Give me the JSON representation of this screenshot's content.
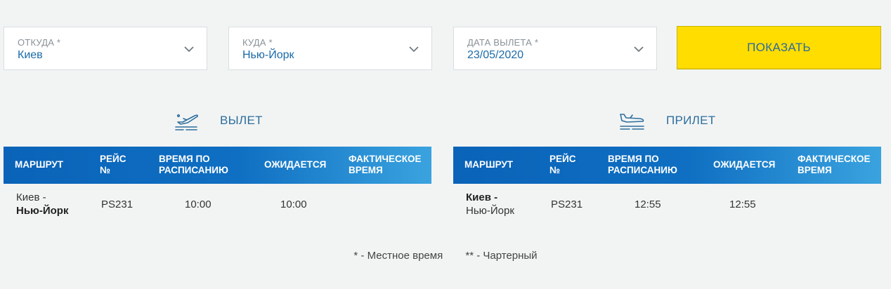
{
  "search": {
    "from": {
      "label": "ОТКУДА *",
      "value": "Киев"
    },
    "to": {
      "label": "КУДА *",
      "value": "Нью-Йорк"
    },
    "date": {
      "label": "ДАТА ВЫЛЕТА *",
      "value": "23/05/2020"
    },
    "show_button": "ПОКАЗАТЬ"
  },
  "departure": {
    "title": "ВЫЛЕТ",
    "icon": "plane-takeoff-icon",
    "columns": [
      "МАРШРУТ",
      "РЕЙС №",
      "ВРЕМЯ ПО РАСПИСАНИЮ",
      "ОЖИДАЕТСЯ",
      "ФАКТИЧЕСКОЕ ВРЕМЯ"
    ],
    "rows": [
      {
        "route_from": "Киев -",
        "route_to": "Нью-Йорк",
        "flight": "PS231",
        "scheduled": "10:00",
        "expected": "10:00",
        "actual": ""
      }
    ]
  },
  "arrival": {
    "title": "ПРИЛЕТ",
    "icon": "plane-landing-icon",
    "columns": [
      "МАРШРУТ",
      "РЕЙС №",
      "ВРЕМЯ ПО РАСПИСАНИЮ",
      "ОЖИДАЕТСЯ",
      "ФАКТИЧЕСКОЕ ВРЕМЯ"
    ],
    "rows": [
      {
        "route_from": "Киев -",
        "route_to": "Нью-Йорк",
        "flight": "PS231",
        "scheduled": "12:55",
        "expected": "12:55",
        "actual": ""
      }
    ]
  },
  "footnotes": {
    "local_time": "* - Местное время",
    "charter": "** - Чартерный"
  },
  "colors": {
    "accent_blue": "#0f6fc2",
    "button_yellow": "#ffdd00",
    "value_blue": "#1b6aa8"
  }
}
